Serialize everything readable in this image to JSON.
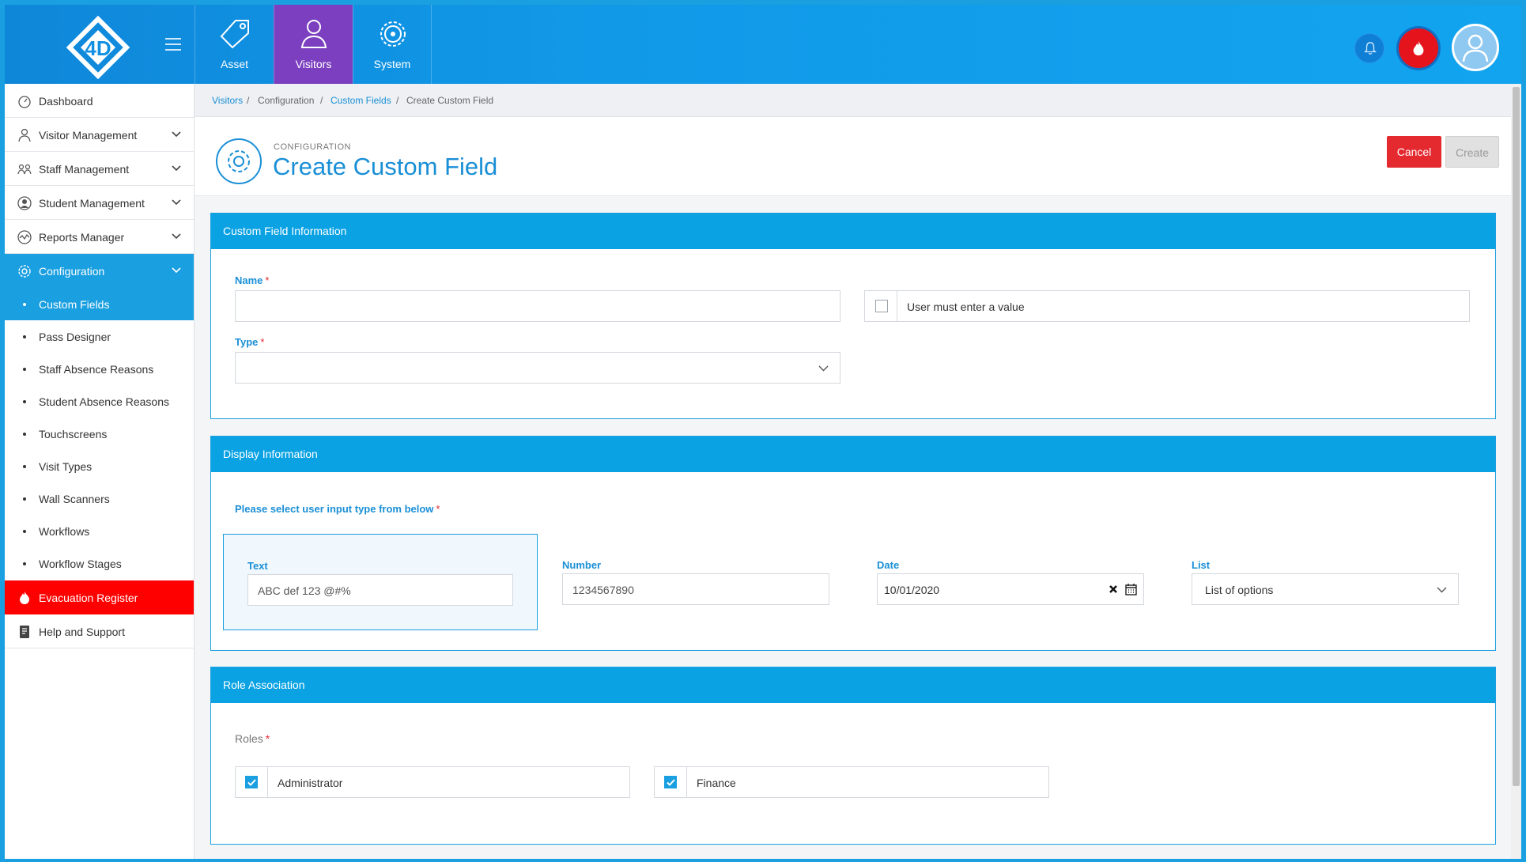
{
  "topbar": {
    "modules": [
      {
        "label": "Asset"
      },
      {
        "label": "Visitors"
      },
      {
        "label": "System"
      }
    ],
    "logo_text": "4D"
  },
  "sidebar": {
    "items": [
      {
        "label": "Dashboard",
        "icon": "dashboard-icon"
      },
      {
        "label": "Visitor Management",
        "icon": "visitor-icon"
      },
      {
        "label": "Staff Management",
        "icon": "staff-icon"
      },
      {
        "label": "Student Management",
        "icon": "student-icon"
      },
      {
        "label": "Reports Manager",
        "icon": "reports-icon"
      },
      {
        "label": "Configuration",
        "icon": "gear-icon"
      }
    ],
    "subitems": [
      {
        "label": "Custom Fields"
      },
      {
        "label": "Pass Designer"
      },
      {
        "label": "Staff Absence Reasons"
      },
      {
        "label": "Student Absence Reasons"
      },
      {
        "label": "Touchscreens"
      },
      {
        "label": "Visit Types"
      },
      {
        "label": "Wall Scanners"
      },
      {
        "label": "Workflows"
      },
      {
        "label": "Workflow Stages"
      }
    ],
    "evacuation": {
      "label": "Evacuation Register"
    },
    "help": {
      "label": "Help and Support"
    }
  },
  "breadcrumb": {
    "items": [
      "Visitors",
      "Configuration",
      "Custom Fields",
      "Create Custom Field"
    ],
    "separator": "/"
  },
  "header": {
    "subtitle": "CONFIGURATION",
    "title": "Create Custom Field",
    "cancel_label": "Cancel",
    "create_label": "Create"
  },
  "custom_field_info": {
    "title": "Custom Field Information",
    "name_label": "Name",
    "name_value": "",
    "required_mark": "*",
    "user_must_enter_label": "User must enter a value",
    "user_must_enter_checked": false,
    "type_label": "Type",
    "type_value": ""
  },
  "display_info": {
    "title": "Display Information",
    "prompt": "Please select user input type from below",
    "options": [
      {
        "label": "Text",
        "value": "ABC def 123 @#%"
      },
      {
        "label": "Number",
        "value": "1234567890"
      },
      {
        "label": "Date",
        "value": "10/01/2020"
      },
      {
        "label": "List",
        "value": "List of options"
      }
    ],
    "selected": "Text"
  },
  "role_association": {
    "title": "Role Association",
    "roles_label": "Roles",
    "roles": [
      {
        "label": "Administrator",
        "checked": true
      },
      {
        "label": "Finance",
        "checked": true
      }
    ]
  },
  "colors": {
    "primary": "#1a9fe0",
    "visitors_tab": "#7b3fbf",
    "evacuation": "#ff0000",
    "cancel": "#e4292f"
  }
}
